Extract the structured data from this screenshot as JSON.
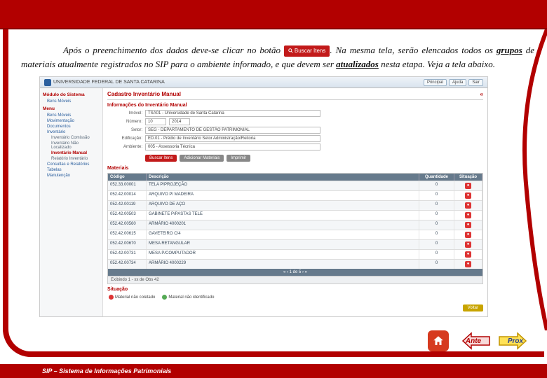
{
  "paragraph": {
    "t1": "Após o preenchimento dos dados deve-se clicar no botão ",
    "btn": "Buscar Itens",
    "t2": ". Na mesma tela, serão elencados todos os ",
    "grupos": "grupos",
    "t3": " de materiais atualmente registrados no SIP para o ambiente informado, e que devem ser ",
    "atual": "atualizados",
    "t4": " nesta etapa. Veja a tela abaixo."
  },
  "shot": {
    "logo": "UNIVERSIDADE FEDERAL DE SANTA CATARINA",
    "topbtns": [
      "Principal",
      "Ajuda",
      "Sair"
    ],
    "sidebar": {
      "h1": "Módulo do Sistema",
      "mod": "Bens Móveis",
      "h2": "Menu",
      "items": [
        "Bens Móveis",
        "Movimentação",
        "Documentos",
        "Inventário"
      ],
      "subs": [
        "Inventário Comissão",
        "Inventário Não Localizado",
        "Inventário Manual",
        "Relatório Inventário"
      ],
      "items2": [
        "Consultas e Relatórios",
        "Tabelas",
        "Manutenção"
      ]
    },
    "main": {
      "title": "Cadastro Inventário Manual",
      "collapse": "«",
      "sec1": "Informações do Inventário Manual",
      "fields": {
        "imovel_l": "Imóvel:",
        "imovel_v": "TSA01 - Universidade de Santa Catarina",
        "num_l": "Número:",
        "num_a": "10",
        "num_b": "2014",
        "setor_l": "Setor:",
        "setor_v": "SEG - DEPARTAMENTO DE GESTÃO PATRIMONIAL",
        "edif_l": "Edificação:",
        "edif_v": "ED.01 - Prédio de Inventário Setor Administração/Reitoria",
        "amb_l": "Ambiente:",
        "amb_v": "005 - Assessoria Técnica"
      },
      "actions": {
        "buscar": "Buscar Itens",
        "adicionar": "Adicionar Materiais",
        "imprimir": "Imprimir"
      },
      "sec2": "Materiais",
      "grid": {
        "headers": {
          "c1": "Código",
          "c2": "Descrição",
          "c3": "Quantidade",
          "c4": "Situação"
        },
        "rows": [
          {
            "c": "052.33.00001",
            "d": "TELA P/PROJEÇÃO",
            "q": "0"
          },
          {
            "c": "052.42.00014",
            "d": "ARQUIVO P/ MADEIRA",
            "q": "0"
          },
          {
            "c": "052.42.00119",
            "d": "ARQUIVO DE AÇO",
            "q": "0"
          },
          {
            "c": "052.42.00503",
            "d": "GABINETE P/PASTAS TELE",
            "q": "0"
          },
          {
            "c": "052.42.00560",
            "d": "ARMÁRIO 4000201",
            "q": "0"
          },
          {
            "c": "052.42.00615",
            "d": "GAVETEIRO C/4",
            "q": "0"
          },
          {
            "c": "052.42.00670",
            "d": "MESA RETANGULAR",
            "q": "0"
          },
          {
            "c": "052.42.00731",
            "d": "MESA P/COMPUTADOR",
            "q": "0"
          },
          {
            "c": "052.42.00734",
            "d": "ARMÁRIO 4000229",
            "q": "0"
          }
        ],
        "footer": "Exibindo 1 - xx de Obs 42",
        "pager": "« ‹ 1 de 5 › »"
      },
      "legend_h": "Situação",
      "legend": [
        {
          "color": "#d33",
          "t": "Material não coletado"
        },
        {
          "color": "#5a5",
          "t": "Material não identificado"
        }
      ],
      "voltar": "Voltar"
    }
  },
  "footer": "SIP – Sistema de Informações Patrimoniais",
  "nav": {
    "prev": "Ante",
    "next": "Prox"
  }
}
